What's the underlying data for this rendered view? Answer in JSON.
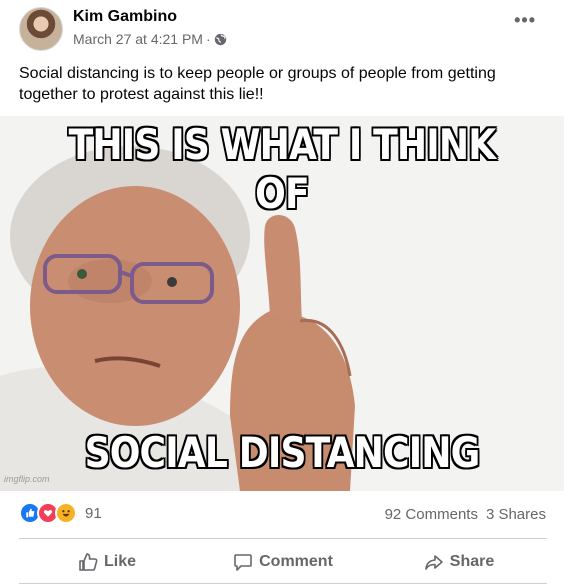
{
  "post": {
    "author": "Kim Gambino",
    "timestamp": "March 27 at 4:21 PM",
    "separator": "·",
    "privacy_icon": "globe-icon",
    "more_label": "•••",
    "text": "Social distancing is to keep people or groups of people from getting together to protest against this lie!!"
  },
  "meme": {
    "top_text": "THIS IS WHAT I THINK OF",
    "bottom_text": "SOCIAL DISTANCING",
    "watermark": "imgflip.com"
  },
  "stats": {
    "reaction_icons": [
      "like-reaction-icon",
      "love-reaction-icon",
      "haha-reaction-icon"
    ],
    "reaction_count": "91",
    "comments": "92 Comments",
    "shares": "3 Shares"
  },
  "actions": {
    "like": "Like",
    "comment": "Comment",
    "share": "Share"
  },
  "colors": {
    "like_blue": "#1877f2",
    "love_red": "#f33e58",
    "haha_yellow": "#f7b125",
    "secondary_text": "#65676b"
  }
}
